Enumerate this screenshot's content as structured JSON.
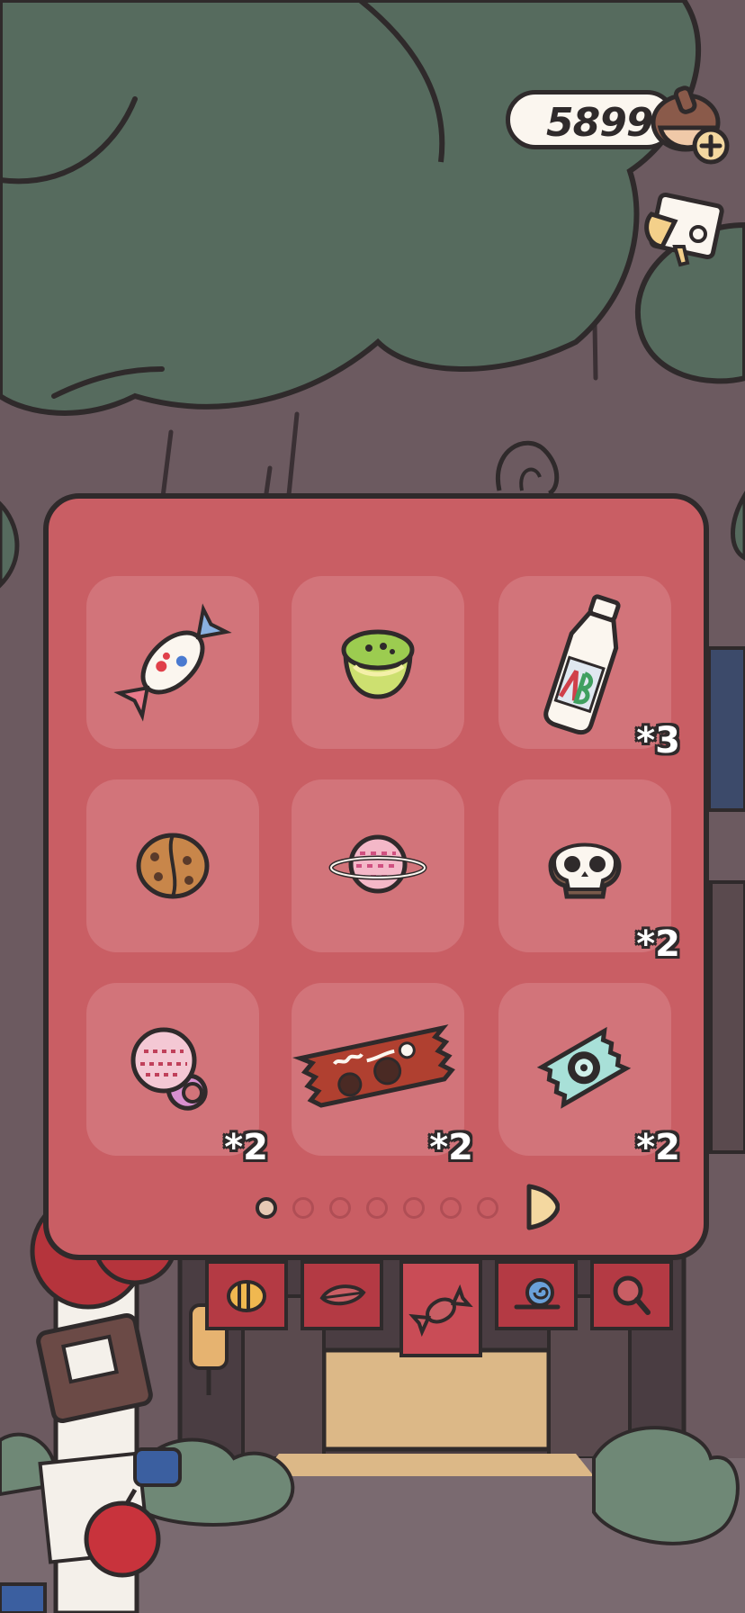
{
  "currency": {
    "amount": "5899"
  },
  "inventory": {
    "slots": [
      {
        "item": "candy",
        "qty": ""
      },
      {
        "item": "jelly-cup",
        "qty": ""
      },
      {
        "item": "milk-bottle",
        "qty": "*3"
      },
      {
        "item": "walnut",
        "qty": ""
      },
      {
        "item": "planet-candy",
        "qty": ""
      },
      {
        "item": "skull-cookie",
        "qty": "*2"
      },
      {
        "item": "ring-pop",
        "qty": "*2"
      },
      {
        "item": "chocolate-bar",
        "qty": "*2"
      },
      {
        "item": "wrapped-candy",
        "qty": "*2"
      }
    ],
    "page_count": 7,
    "current_page": 1
  },
  "category_flags": [
    "bee-icon",
    "leaf-icon",
    "candy-icon",
    "snail-icon",
    "magnifier-icon"
  ],
  "colors": {
    "panel": "#c95e64",
    "slot": "#d2747a",
    "outline": "#2f2a2b",
    "tree": "#566b5e",
    "trunk": "#6c5a60"
  }
}
